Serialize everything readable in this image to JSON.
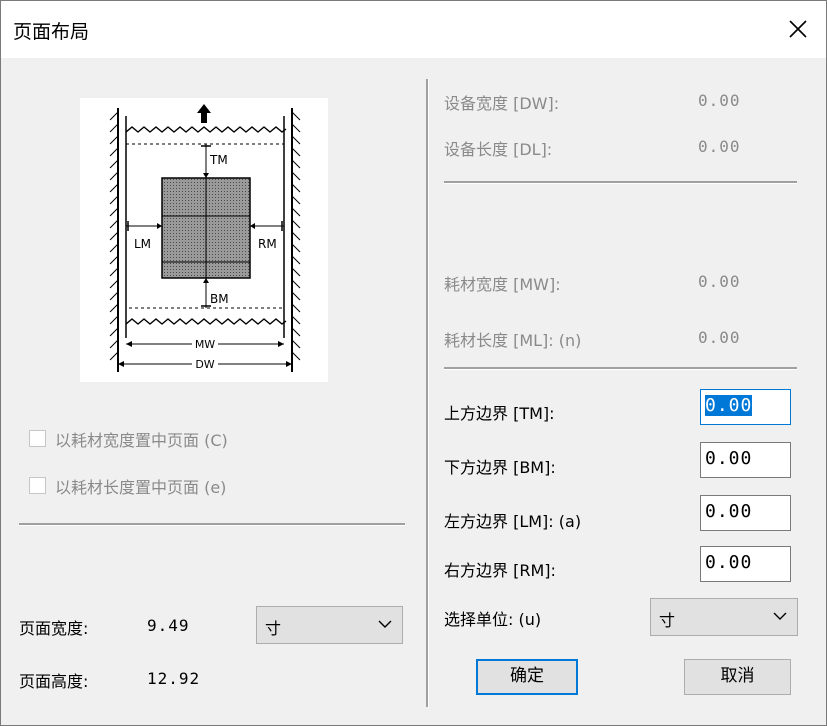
{
  "dialog": {
    "title": "页面布局"
  },
  "preview": {
    "tm": "TM",
    "bm": "BM",
    "lm": "LM",
    "rm": "RM",
    "mw": "MW",
    "dw": "DW"
  },
  "left": {
    "center_width_label": "以耗材宽度置中页面 (C)",
    "center_length_label": "以耗材长度置中页面 (e)",
    "page_width_label": "页面宽度:",
    "page_width_value": "9.49",
    "page_height_label": "页面高度:",
    "page_height_value": "12.92",
    "page_unit": "寸"
  },
  "right": {
    "device_width_label": "设备宽度 [DW]:",
    "device_width_value": "0.00",
    "device_length_label": "设备长度 [DL]:",
    "device_length_value": "0.00",
    "media_width_label": "耗材宽度 [MW]:",
    "media_width_value": "0.00",
    "media_length_label": "耗材长度 [ML]: (n)",
    "media_length_value": "0.00",
    "top_margin_label": "上方边界 [TM]:",
    "top_margin_value": "0.00",
    "bottom_margin_label": "下方边界 [BM]:",
    "bottom_margin_value": "0.00",
    "left_margin_label": "左方边界 [LM]: (a)",
    "left_margin_value": "0.00",
    "right_margin_label": "右方边界 [RM]:",
    "right_margin_value": "0.00",
    "unit_label": "选择单位: (u)",
    "unit_value": "寸",
    "ok_label": "确定",
    "cancel_label": "取消"
  }
}
